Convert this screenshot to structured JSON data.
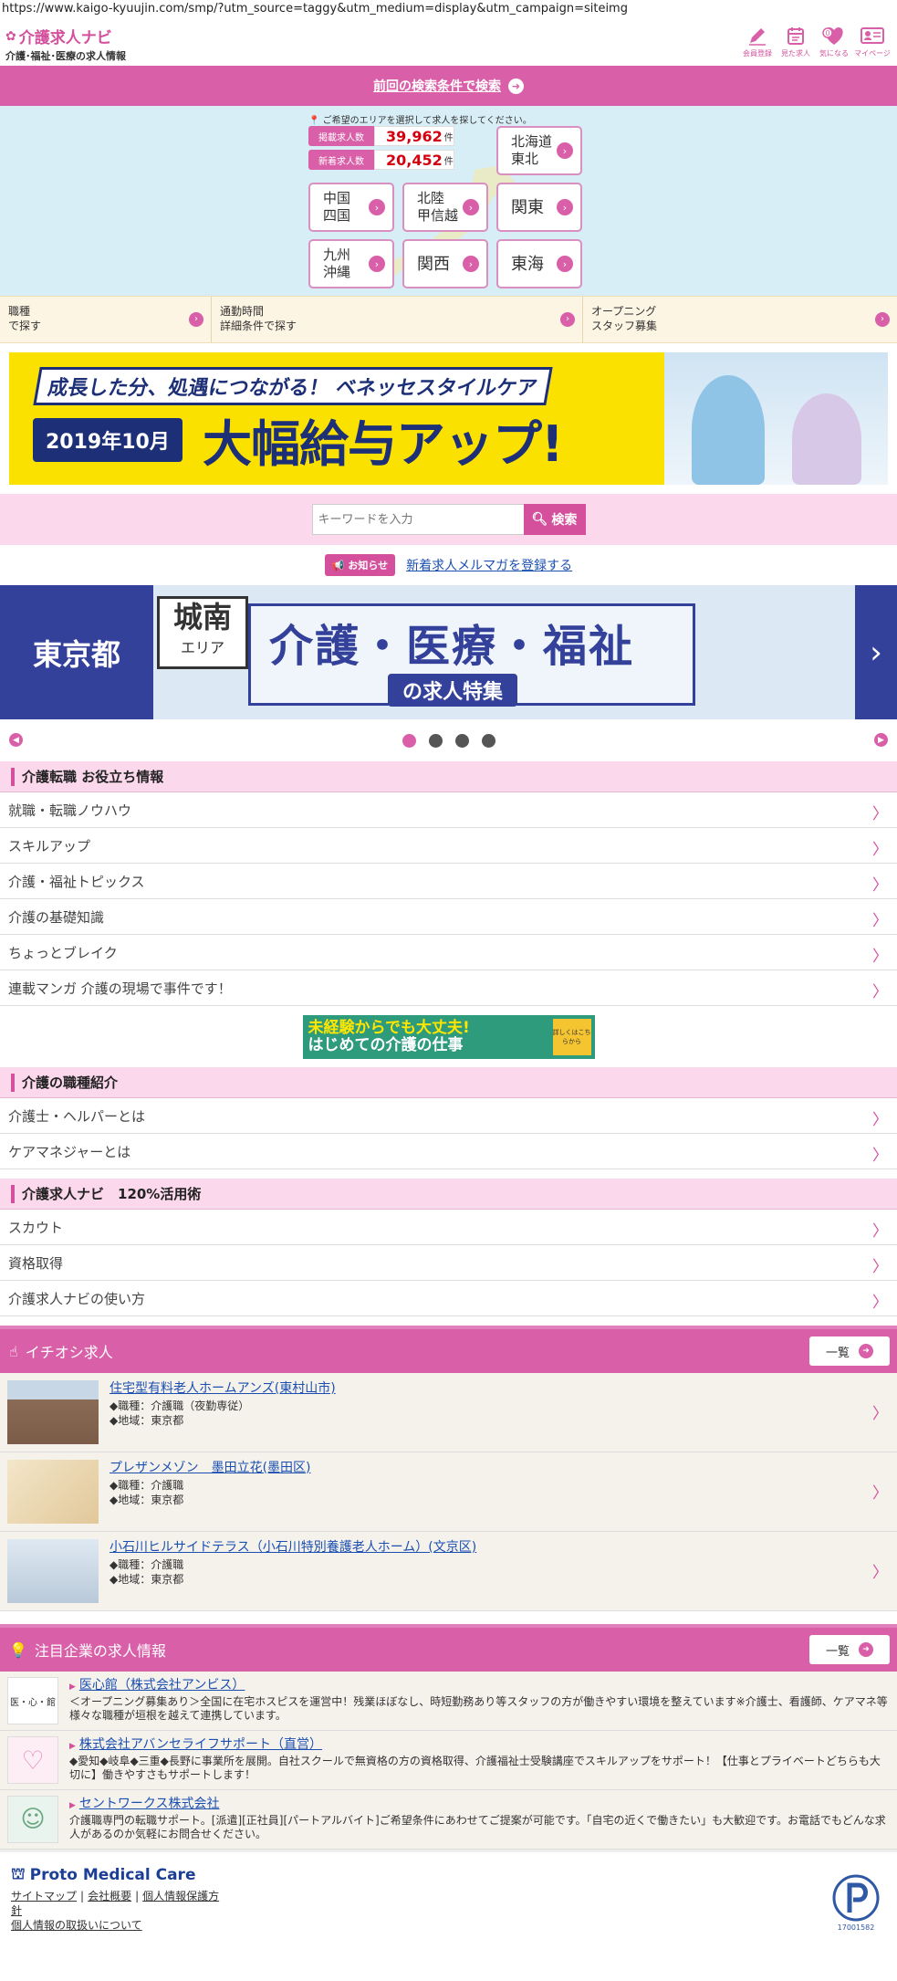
{
  "url": "https://www.kaigo-kyuujin.com/smp/?utm_source=taggy&utm_medium=display&utm_campaign=siteimg",
  "logo": {
    "title": "介護求人ナビ",
    "subtitle": "介護･福祉･医療の求人情報"
  },
  "header_icons": [
    {
      "label": "会員登録",
      "icon": "pencil-icon"
    },
    {
      "label": "見た求人",
      "icon": "calendar-icon"
    },
    {
      "label": "気になる",
      "icon": "heart-icon",
      "badge": "0"
    },
    {
      "label": "マイページ",
      "icon": "mypage-icon"
    }
  ],
  "prev_search": "前回の検索条件で検索",
  "area": {
    "note": "ご希望のエリアを選択して求人を探してください。",
    "counts": [
      {
        "label": "掲載求人数",
        "value": "39,962",
        "unit": "件"
      },
      {
        "label": "新着求人数",
        "value": "20,452",
        "unit": "件"
      }
    ],
    "buttons": [
      "北海道\n東北",
      "中国\n四国",
      "北陸\n甲信越",
      "関東",
      "九州\n沖縄",
      "関西",
      "東海"
    ]
  },
  "tabs": [
    "職種\nで探す",
    "通勤時間\n詳細条件で探す",
    "オープニング\nスタッフ募集"
  ],
  "banner1": {
    "line1": "成長した分、処遇につながる！ ベネッセスタイルケア",
    "line2": "2019年10月",
    "line3": "大幅給与アップ!"
  },
  "search": {
    "placeholder": "キーワードを入力",
    "button": "検索"
  },
  "notice": {
    "badge": "お知らせ",
    "link": "新着求人メルマガを登録する"
  },
  "banner2": {
    "left": "東京都",
    "area1": "城南",
    "area2": "エリア",
    "main1": "介護・医療・福祉",
    "main2": "の求人特集"
  },
  "sections": [
    {
      "title": "介護転職 お役立ち情報",
      "items": [
        "就職・転職ノウハウ",
        "スキルアップ",
        "介護・福祉トピックス",
        "介護の基礎知識",
        "ちょっとブレイク",
        "連載マンガ 介護の現場で事件です！"
      ]
    },
    {
      "title": "介護の職種紹介",
      "items": [
        "介護士・ヘルパーとは",
        "ケアマネジャーとは"
      ]
    },
    {
      "title": "介護求人ナビ　120%活用術",
      "items": [
        "スカウト",
        "資格取得",
        "介護求人ナビの使い方"
      ]
    }
  ],
  "mid_banner": {
    "t1": "未経験からでも大丈夫!",
    "t2": "はじめての介護の仕事",
    "side": "詳しくはこちらから"
  },
  "featured": {
    "title": "イチオシ求人",
    "more": "一覧",
    "jobs": [
      {
        "title": "住宅型有料老人ホームアンズ(東村山市)",
        "type": "◆職種：介護職（夜勤専従）",
        "area": "◆地域：東京都"
      },
      {
        "title": "プレザンメゾン　墨田立花(墨田区)",
        "type": "◆職種：介護職",
        "area": "◆地域：東京都"
      },
      {
        "title": "小石川ヒルサイドテラス（小石川特別養護老人ホーム）(文京区)",
        "type": "◆職種：介護職",
        "area": "◆地域：東京都"
      }
    ]
  },
  "companies": {
    "title": "注目企業の求人情報",
    "more": "一覧",
    "items": [
      {
        "title": "医心館（株式会社アンビス）",
        "desc": "＜オープニング募集あり＞全国に在宅ホスピスを運営中！残業ほぼなし、時短勤務あり等スタッフの方が働きやすい環境を整えています※介護士、看護師、ケアマネ等様々な職種が垣根を越えて連携しています。",
        "logo": "医・心・館"
      },
      {
        "title": "株式会社アバンセライフサポート（直営）",
        "desc": "◆愛知◆岐阜◆三重◆長野に事業所を展開。自社スクールで無資格の方の資格取得、介護福祉士受験講座でスキルアップをサポート！【仕事とプライベートどちらも大切に】働きやすさもサポートします！",
        "logo": ""
      },
      {
        "title": "セントワークス株式会社",
        "desc": "介護職専門の転職サポート。[派遣][正社員][パートアルバイト]ご希望条件にあわせてご提案が可能です。「自宅の近くで働きたい」も大歓迎です。お電話でもどんな求人があるのか気軽にお問合せください。",
        "logo": ""
      }
    ]
  },
  "footer": {
    "brand": "Proto Medical Care",
    "links": [
      "サイトマップ",
      "会社概要",
      "個人情報保護方針",
      "個人情報の取扱いについて"
    ],
    "privacy_num": "17001582"
  },
  "colors": {
    "brand_pink": "#d960a8",
    "navy": "#1c2f77",
    "link_blue": "#1b4fb0"
  }
}
